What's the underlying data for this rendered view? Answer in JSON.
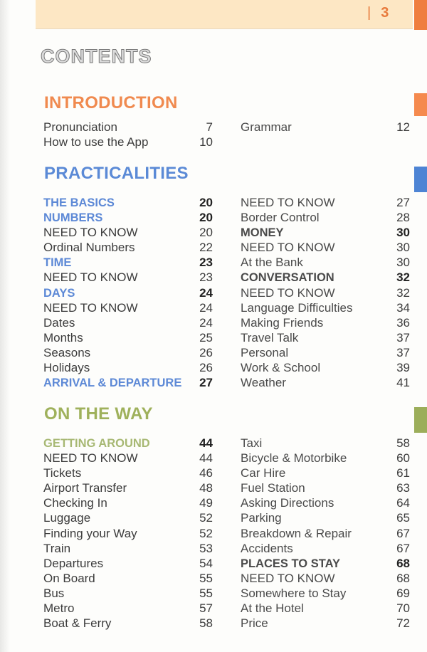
{
  "header": {
    "page_number": "3",
    "separator": "|"
  },
  "title": "CONTENTS",
  "colors": {
    "introduction": "#f08a4f",
    "practicalities": "#5b8ad6",
    "on_the_way": "#9fb15c",
    "header_band": "#fde7c4"
  },
  "sections": {
    "introduction": {
      "title": "INTRODUCTION",
      "left": [
        {
          "label": "Pronunciation",
          "page": "7"
        },
        {
          "label": "How to use the App",
          "page": "10"
        }
      ],
      "right": [
        {
          "label": "Grammar",
          "page": "12"
        }
      ]
    },
    "practicalities": {
      "title": "PRACTICALITIES",
      "left": [
        {
          "label": "THE BASICS",
          "page": "20",
          "heading": true
        },
        {
          "label": "NUMBERS",
          "page": "20",
          "heading": true
        },
        {
          "label": "NEED TO KNOW",
          "page": "20"
        },
        {
          "label": "Ordinal Numbers",
          "page": "22"
        },
        {
          "label": "TIME",
          "page": "23",
          "heading": true
        },
        {
          "label": "NEED TO KNOW",
          "page": "23"
        },
        {
          "label": "DAYS",
          "page": "24",
          "heading": true
        },
        {
          "label": "NEED TO KNOW",
          "page": "24"
        },
        {
          "label": "Dates",
          "page": "24"
        },
        {
          "label": "Months",
          "page": "25"
        },
        {
          "label": "Seasons",
          "page": "26"
        },
        {
          "label": "Holidays",
          "page": "26"
        },
        {
          "label": "ARRIVAL & DEPARTURE",
          "page": "27",
          "heading": true
        }
      ],
      "right": [
        {
          "label": "NEED TO KNOW",
          "page": "27"
        },
        {
          "label": "Border Control",
          "page": "28"
        },
        {
          "label": "MONEY",
          "page": "30",
          "heading": true
        },
        {
          "label": "NEED TO KNOW",
          "page": "30"
        },
        {
          "label": "At the Bank",
          "page": "30"
        },
        {
          "label": "CONVERSATION",
          "page": "32",
          "heading": true
        },
        {
          "label": "NEED TO KNOW",
          "page": "32"
        },
        {
          "label": "Language Difficulties",
          "page": "34"
        },
        {
          "label": "Making Friends",
          "page": "36"
        },
        {
          "label": "Travel Talk",
          "page": "37"
        },
        {
          "label": "Personal",
          "page": "37"
        },
        {
          "label": "Work & School",
          "page": "39"
        },
        {
          "label": "Weather",
          "page": "41"
        }
      ]
    },
    "on_the_way": {
      "title": "ON THE WAY",
      "left": [
        {
          "label": "GETTING AROUND",
          "page": "44",
          "heading": true
        },
        {
          "label": "NEED TO KNOW",
          "page": "44"
        },
        {
          "label": "Tickets",
          "page": "46"
        },
        {
          "label": "Airport Transfer",
          "page": "48"
        },
        {
          "label": "Checking In",
          "page": "49"
        },
        {
          "label": "Luggage",
          "page": "52"
        },
        {
          "label": "Finding your Way",
          "page": "52"
        },
        {
          "label": "Train",
          "page": "53"
        },
        {
          "label": "Departures",
          "page": "54"
        },
        {
          "label": "On Board",
          "page": "55"
        },
        {
          "label": "Bus",
          "page": "55"
        },
        {
          "label": "Metro",
          "page": "57"
        },
        {
          "label": "Boat & Ferry",
          "page": "58"
        }
      ],
      "right": [
        {
          "label": "Taxi",
          "page": "58"
        },
        {
          "label": "Bicycle & Motorbike",
          "page": "60"
        },
        {
          "label": "Car Hire",
          "page": "61"
        },
        {
          "label": "Fuel Station",
          "page": "63"
        },
        {
          "label": "Asking Directions",
          "page": "64"
        },
        {
          "label": "Parking",
          "page": "65"
        },
        {
          "label": "Breakdown & Repair",
          "page": "67"
        },
        {
          "label": "Accidents",
          "page": "67"
        },
        {
          "label": "PLACES TO STAY",
          "page": "68",
          "heading": true
        },
        {
          "label": "NEED TO KNOW",
          "page": "68"
        },
        {
          "label": "Somewhere to Stay",
          "page": "69"
        },
        {
          "label": "At the Hotel",
          "page": "70"
        },
        {
          "label": "Price",
          "page": "72"
        }
      ]
    }
  }
}
